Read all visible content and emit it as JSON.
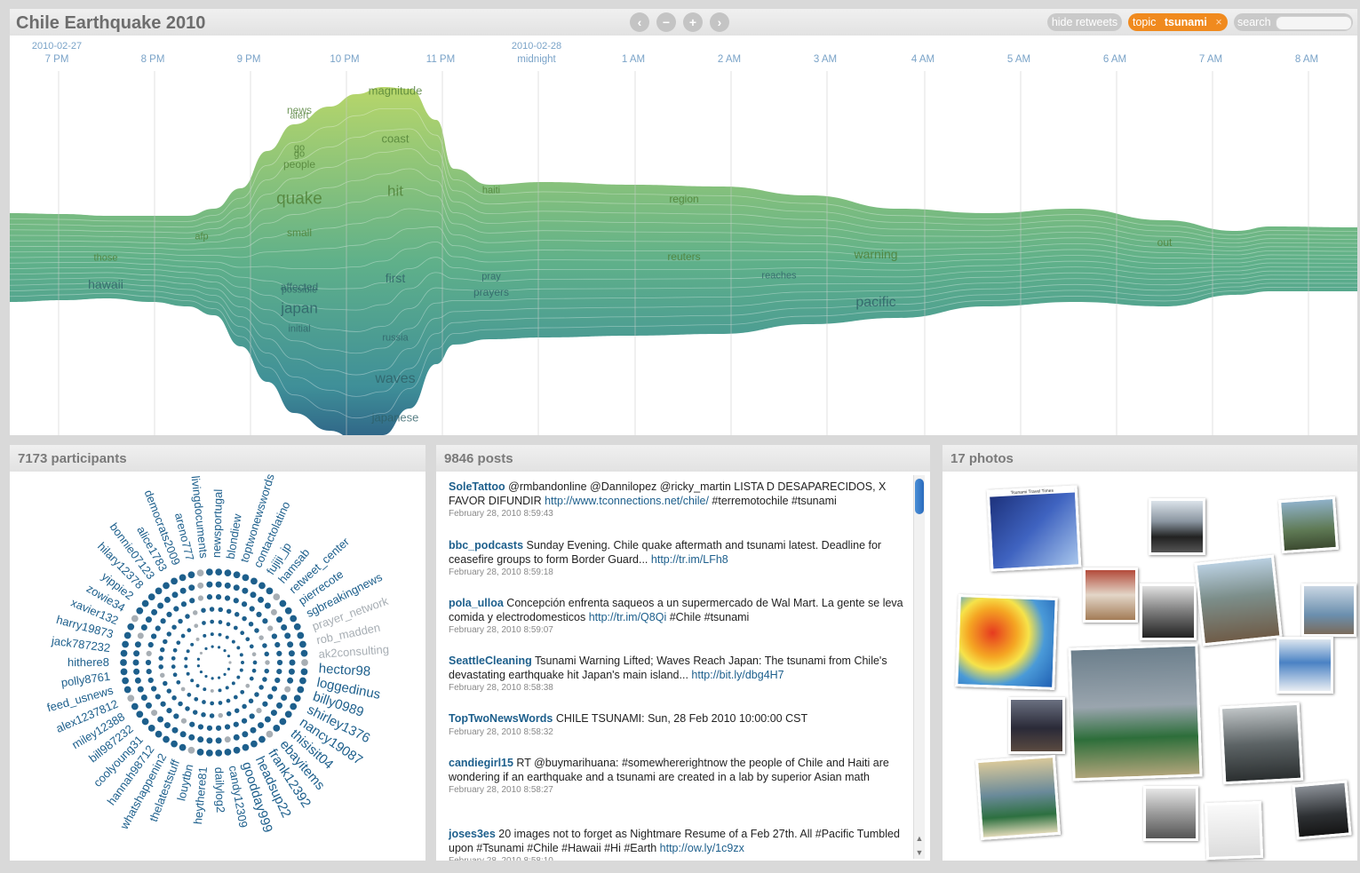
{
  "app": {
    "title": "Chile Earthquake 2010"
  },
  "toolbar": {
    "nav": [
      "‹",
      "−",
      "+",
      "›"
    ],
    "hide_retweets": "hide retweets",
    "topic_prefix": "topic",
    "topic_value": "tsunami",
    "topic_close": "×",
    "search_label": "search"
  },
  "timeline": {
    "ticks": [
      {
        "date": "2010-02-27",
        "label": "7 PM"
      },
      {
        "date": "",
        "label": "8 PM"
      },
      {
        "date": "",
        "label": "9 PM"
      },
      {
        "date": "",
        "label": "10 PM"
      },
      {
        "date": "",
        "label": "11 PM"
      },
      {
        "date": "2010-02-28",
        "label": "midnight"
      },
      {
        "date": "",
        "label": "1 AM"
      },
      {
        "date": "",
        "label": "2 AM"
      },
      {
        "date": "",
        "label": "3 AM"
      },
      {
        "date": "",
        "label": "4 AM"
      },
      {
        "date": "",
        "label": "5 AM"
      },
      {
        "date": "",
        "label": "6 AM"
      },
      {
        "date": "",
        "label": "7 AM"
      },
      {
        "date": "",
        "label": "8 AM"
      }
    ],
    "words": [
      "magnitude",
      "news",
      "alert",
      "coast",
      "go",
      "go",
      "people",
      "quake",
      "hit",
      "haiti",
      "region",
      "afp",
      "small",
      "those",
      "reuters",
      "warning",
      "out",
      "hawaii",
      "first",
      "pray",
      "affected",
      "possible",
      "prayers",
      "reaches",
      "japan",
      "pacific",
      "initial",
      "russia",
      "waves",
      "japanese"
    ],
    "colors": {
      "top": "#b7d66a",
      "mid": "#5fb08a",
      "low": "#3f8f98",
      "bottom": "#2f6487"
    }
  },
  "participants": {
    "title": "7173 participants",
    "names": [
      "livingdocuments",
      "newsportugal",
      "blondiew",
      "toptwonewswords",
      "contactolatino",
      "fujiji_jp",
      "hamsab",
      "retweet_center",
      "pierrecote",
      "sgbreakingnews",
      "prayer_network",
      "rob_madden",
      "ak2consulting",
      "hector98",
      "loggedinus",
      "billy0989",
      "shirley1376",
      "nancy19087",
      "thisisit04",
      "ebayitems",
      "frank12392",
      "headsup22",
      "goodday999",
      "candy12309",
      "dailylog2",
      "heythere81",
      "louytbn",
      "thelateststuff",
      "whatshappenin2",
      "hannah98712",
      "coolyoung31",
      "bill987232",
      "miley12388",
      "alex1237812",
      "feed_usnews",
      "polly8761",
      "hithere8",
      "jack787232",
      "harry19873",
      "xavier132",
      "zowie34",
      "yippie2",
      "hilary12378",
      "bonnie07123",
      "alice1783",
      "democrats2009",
      "areno777"
    ],
    "colors": {
      "main": "#1d5f8c",
      "light": "#a7aeb4"
    }
  },
  "posts": {
    "title": "9846 posts",
    "items": [
      {
        "user": "SoleTattoo",
        "text": "@rmbandonline @Dannilopez @ricky_martin LISTA D DESAPARECIDOS, X FAVOR DIFUNDIR",
        "link": "http://www.tconnections.net/chile/",
        "tail": "#terremotochile #tsunami",
        "date": "February 28, 2010 8:59:43"
      },
      {
        "user": "bbc_podcasts",
        "text": "Sunday Evening. Chile quake aftermath and tsunami latest. Deadline for ceasefire groups to form Border Guard...",
        "link": "http://tr.im/LFh8",
        "tail": "",
        "date": "February 28, 2010 8:59:18"
      },
      {
        "user": "pola_ulloa",
        "text": "Concepción enfrenta saqueos a un supermercado de Wal Mart. La gente se leva comida y electrodomesticos",
        "link": "http://tr.im/Q8Qi",
        "tail": "#Chile #tsunami",
        "date": "February 28, 2010 8:59:07"
      },
      {
        "user": "SeattleCleaning",
        "text": "Tsunami Warning Lifted; Waves Reach Japan: The tsunami from Chile's devastating earthquake hit Japan's main island...",
        "link": "http://bit.ly/dbg4H7",
        "tail": "",
        "date": "February 28, 2010 8:58:38"
      },
      {
        "user": "TopTwoNewsWords",
        "text": "CHILE TSUNAMI: Sun, 28 Feb 2010 10:00:00 CST",
        "link": "",
        "tail": "",
        "date": "February 28, 2010 8:58:32"
      },
      {
        "user": "candiegirl15",
        "text": "RT @buymarihuana: #somewhererightnow the people of Chile and Haiti are wondering if an earthquake and a tsunami are created in a lab by superior Asian math",
        "link": "",
        "tail": "",
        "date": "February 28, 2010 8:58:27"
      },
      {
        "user": "joses3es",
        "text": "20 images not to forget as Nightmare Resume of a Feb 27th. All #Pacific Tumbled upon #Tsunami #Chile #Hawaii #Hi #Earth",
        "link": "http://ow.ly/1c9zx",
        "tail": "",
        "date": "February 28, 2010 8:58:10"
      }
    ]
  },
  "photos": {
    "title": "17 photos",
    "map_caption": "Tsunami Travel Times",
    "items": [
      "tsunami-travel-times-map",
      "man-in-dark-photo",
      "mountain-lake-photo",
      "food-table-photo",
      "cracked-road-photo",
      "coastal-town-photo",
      "shoreline-photo",
      "wave-energy-map",
      "tv-news-japan-map",
      "website-screenshot",
      "dark-mountain-photo",
      "stormy-sea-photo",
      "tv-news-building-photo",
      "debris-street-photo",
      "sketch-drawing-photo",
      "dark-beach-photo"
    ]
  }
}
